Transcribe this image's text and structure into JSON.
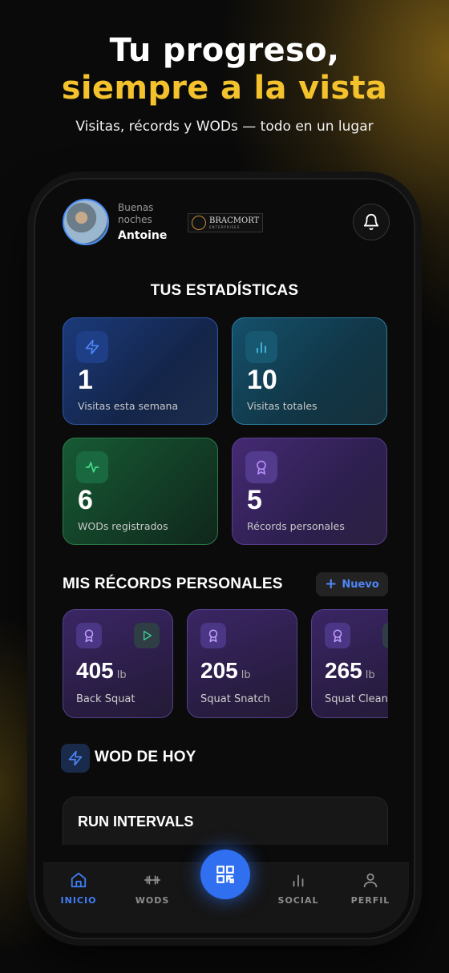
{
  "hero": {
    "line1": "Tu progreso,",
    "line2": "siempre a la vista",
    "subtitle": "Visitas, récords y WODs — todo en un lugar"
  },
  "header": {
    "greeting": "Buenas noches",
    "user_name": "Antoine",
    "brand_name": "BRACMORT",
    "brand_sub": "ENTERPRISES"
  },
  "stats": {
    "title": "TUS ESTADÍSTICAS",
    "cards": [
      {
        "value": "1",
        "label": "Visitas esta semana",
        "icon": "zap-icon",
        "color": "#3a6de0"
      },
      {
        "value": "10",
        "label": "Visitas totales",
        "icon": "bar-chart-icon",
        "color": "#3ab0d8"
      },
      {
        "value": "6",
        "label": "WODs registrados",
        "icon": "activity-icon",
        "color": "#3ccf7a"
      },
      {
        "value": "5",
        "label": "Récords personales",
        "icon": "award-icon",
        "color": "#a070f0"
      }
    ]
  },
  "records": {
    "title": "MIS RÉCORDS PERSONALES",
    "new_label": "Nuevo",
    "items": [
      {
        "value": "405",
        "unit": "lb",
        "name": "Back Squat"
      },
      {
        "value": "205",
        "unit": "lb",
        "name": "Squat Snatch"
      },
      {
        "value": "265",
        "unit": "lb",
        "name": "Squat Clean"
      }
    ]
  },
  "wod": {
    "title": "WOD DE HOY",
    "workout_name": "RUN INTERVALS"
  },
  "tabbar": {
    "items": [
      {
        "label": "INICIO",
        "icon": "home-icon",
        "active": true
      },
      {
        "label": "WODS",
        "icon": "dumbbell-icon",
        "active": false
      },
      {
        "label": "SOCIAL",
        "icon": "bar-chart-icon",
        "active": false
      },
      {
        "label": "PERFIL",
        "icon": "user-icon",
        "active": false
      }
    ],
    "center_icon": "qr-code-icon"
  },
  "colors": {
    "accent_yellow": "#f3c22c",
    "accent_blue": "#2f6ff0"
  }
}
